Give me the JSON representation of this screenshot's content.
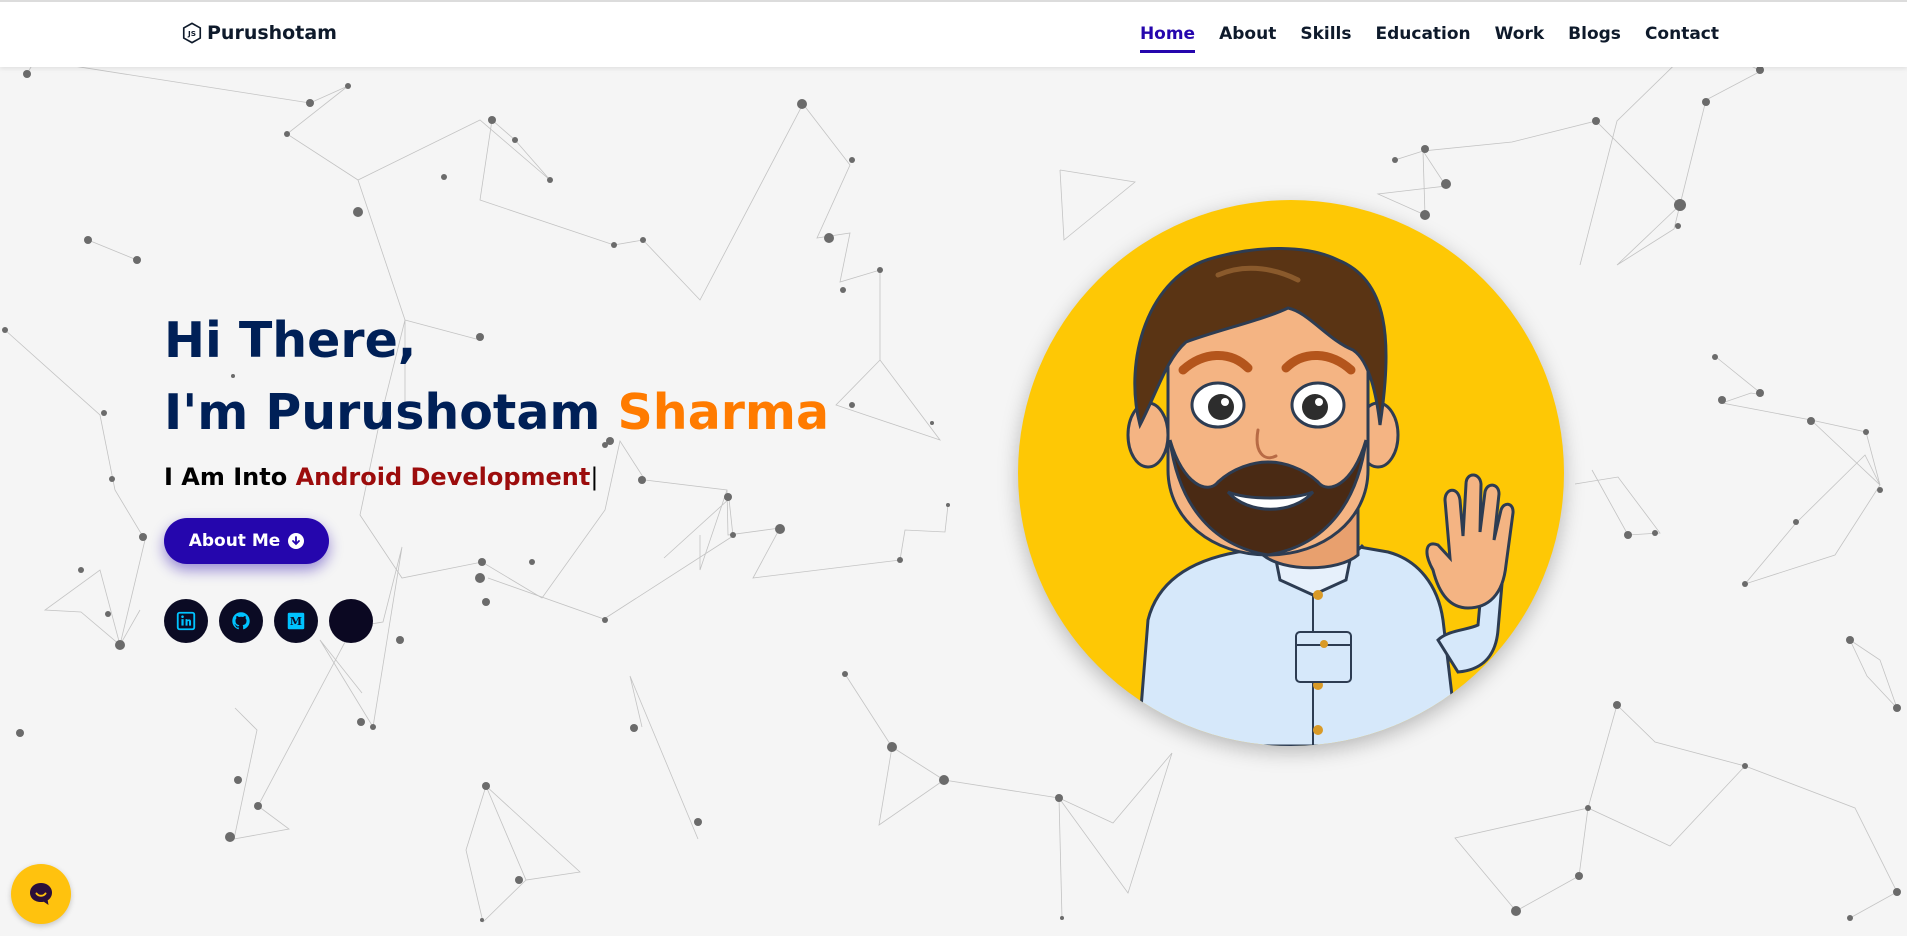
{
  "brand": {
    "name": "Purushotam",
    "icon": "js-hexagon-icon"
  },
  "nav": {
    "items": [
      {
        "label": "Home",
        "active": true
      },
      {
        "label": "About",
        "active": false
      },
      {
        "label": "Skills",
        "active": false
      },
      {
        "label": "Education",
        "active": false
      },
      {
        "label": "Work",
        "active": false
      },
      {
        "label": "Blogs",
        "active": false
      },
      {
        "label": "Contact",
        "active": false
      }
    ]
  },
  "hero": {
    "greeting": "Hi There,",
    "name_prefix": "I'm Purushotam ",
    "name_accent": "Sharma",
    "into_prefix": "I Am Into ",
    "into_typed": "Android Development",
    "cursor": "|",
    "about_button": "About Me"
  },
  "socials": [
    {
      "icon": "linkedin-icon"
    },
    {
      "icon": "github-icon"
    },
    {
      "icon": "medium-icon"
    },
    {
      "icon": "blank-icon"
    }
  ],
  "chat": {
    "icon": "chat-bubble-icon"
  },
  "colors": {
    "primary": "#2506ad",
    "heading": "#002057",
    "accent": "#ff7b00",
    "typed": "#9c0c0c",
    "avatar_bg": "#fec805",
    "social_icon": "#00c3ff"
  }
}
